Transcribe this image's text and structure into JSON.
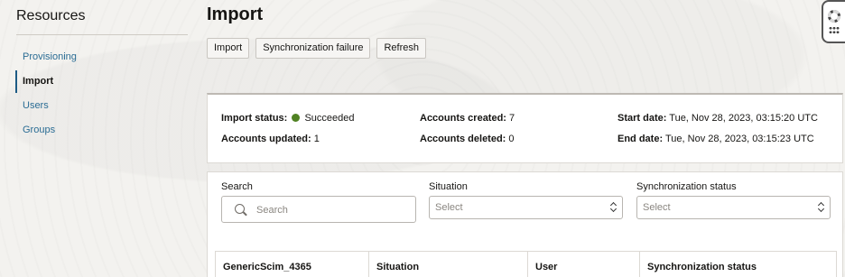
{
  "sidebar": {
    "title": "Resources",
    "items": [
      {
        "label": "Provisioning"
      },
      {
        "label": "Import"
      },
      {
        "label": "Users"
      },
      {
        "label": "Groups"
      }
    ]
  },
  "page": {
    "title": "Import"
  },
  "toolbar": {
    "import_label": "Import",
    "sync_failure_label": "Synchronization failure",
    "refresh_label": "Refresh"
  },
  "help_icons": [
    "lifebuoy-icon",
    "grid-icon"
  ],
  "status": {
    "import_status_label": "Import status:",
    "import_status_value": "Succeeded",
    "status_color": "#508223",
    "accounts_updated_label": "Accounts updated:",
    "accounts_updated_value": "1",
    "accounts_created_label": "Accounts created:",
    "accounts_created_value": "7",
    "accounts_deleted_label": "Accounts deleted:",
    "accounts_deleted_value": "0",
    "start_date_label": "Start date:",
    "start_date_value": "Tue, Nov 28, 2023, 03:15:20 UTC",
    "end_date_label": "End date:",
    "end_date_value": "Tue, Nov 28, 2023, 03:15:23 UTC"
  },
  "filters": {
    "search_label": "Search",
    "search_placeholder": "Search",
    "situation_label": "Situation",
    "situation_value": "Select",
    "sync_status_label": "Synchronization status",
    "sync_status_value": "Select"
  },
  "table": {
    "columns": [
      "GenericScim_4365",
      "Situation",
      "User",
      "Synchronization status"
    ]
  },
  "colors": {
    "accent": "#2a6c94",
    "success": "#508223"
  }
}
